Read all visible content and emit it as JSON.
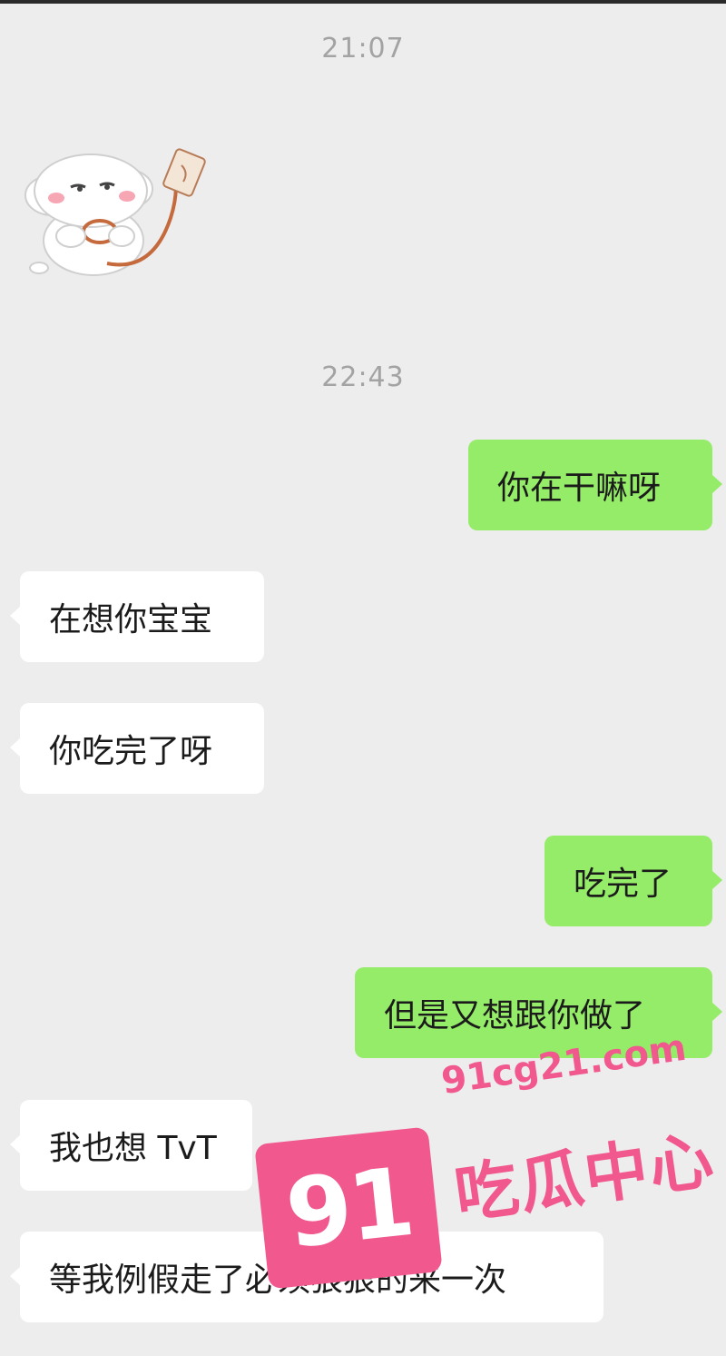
{
  "timestamps": [
    "21:07",
    "22:43"
  ],
  "sticker": {
    "icon": "sticker-rabbit-holding-leash-icon"
  },
  "messages": [
    {
      "side": "out",
      "text": "你在干嘛呀"
    },
    {
      "side": "in",
      "text": "在想你宝宝"
    },
    {
      "side": "in",
      "text": "你吃完了呀"
    },
    {
      "side": "out",
      "text": "吃完了"
    },
    {
      "side": "out",
      "text": "但是又想跟你做了"
    },
    {
      "side": "in",
      "text": "我也想 TvT"
    },
    {
      "side": "in",
      "text": "等我例假走了必须狠狠的来一次"
    }
  ],
  "watermark": {
    "number": "91",
    "url": "91cg21.com",
    "name": "吃瓜中心"
  },
  "colors": {
    "background": "#ededed",
    "outgoing": "#95ec69",
    "incoming": "#ffffff",
    "watermark": "#f0588e",
    "timestamp": "#a3a3a3"
  }
}
